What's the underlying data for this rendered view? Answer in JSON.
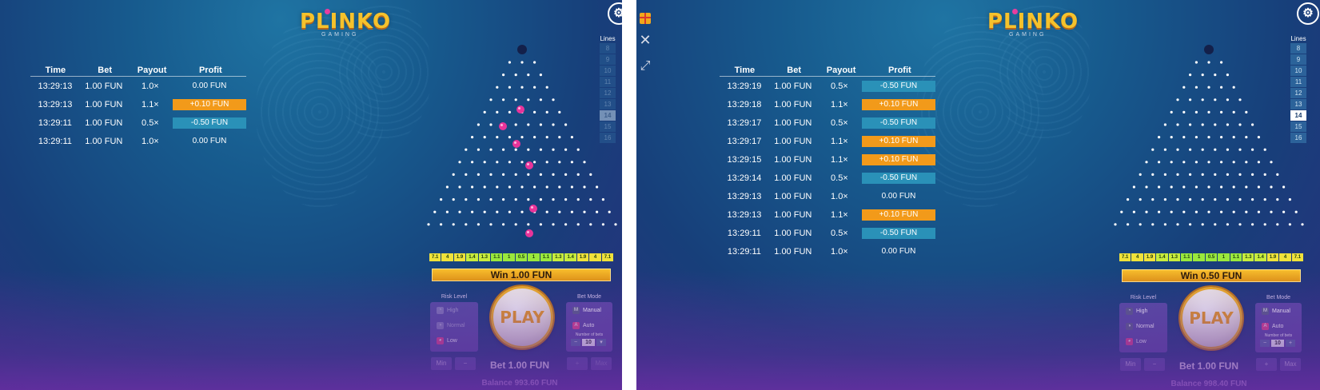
{
  "panel1": {
    "logo": {
      "title": "PLINKO",
      "subtitle": "GAMING"
    },
    "settings_icon": "settings-icon",
    "history": {
      "headers": [
        "Time",
        "Bet",
        "Payout",
        "Profit"
      ],
      "rows": [
        {
          "time": "13:29:13",
          "bet": "1.00 FUN",
          "payout": "1.0×",
          "profit": "0.00 FUN",
          "kind": "none"
        },
        {
          "time": "13:29:13",
          "bet": "1.00 FUN",
          "payout": "1.1×",
          "profit": "+0.10 FUN",
          "kind": "win"
        },
        {
          "time": "13:29:11",
          "bet": "1.00 FUN",
          "payout": "0.5×",
          "profit": "-0.50 FUN",
          "kind": "loss"
        },
        {
          "time": "13:29:11",
          "bet": "1.00 FUN",
          "payout": "1.0×",
          "profit": "0.00 FUN",
          "kind": "none"
        }
      ]
    },
    "lines": {
      "label": "Lines",
      "options": [
        "8",
        "9",
        "10",
        "11",
        "12",
        "13",
        "14",
        "15",
        "16"
      ],
      "selected": "14"
    },
    "multipliers": [
      "7.1",
      "4",
      "1.9",
      "1.4",
      "1.3",
      "1.1",
      "1",
      "0.5",
      "1",
      "1.1",
      "1.3",
      "1.4",
      "1.9",
      "4",
      "7.1"
    ],
    "win_text": "Win 1.00 FUN",
    "risk": {
      "title": "Risk Level",
      "options": [
        "High",
        "Normal",
        "Low"
      ],
      "selected": "Low"
    },
    "play_label": "PLAY",
    "bet_mode": {
      "title": "Bet Mode",
      "manual": "Manual",
      "auto": "Auto",
      "number_label": "Number of bets",
      "number": "10"
    },
    "bet_text": "Bet 1.00 FUN",
    "min_label": "Min",
    "max_label": "Max",
    "minus_label": "−",
    "plus_label": "+",
    "balance_text": "Balance 993.60 FUN"
  },
  "panel2": {
    "logo": {
      "title": "PLINKO",
      "subtitle": "GAMING"
    },
    "settings_icon": "settings-icon",
    "side_icons": [
      "gift-icon",
      "close-icon",
      "expand-icon"
    ],
    "history": {
      "headers": [
        "Time",
        "Bet",
        "Payout",
        "Profit"
      ],
      "rows": [
        {
          "time": "13:29:19",
          "bet": "1.00 FUN",
          "payout": "0.5×",
          "profit": "-0.50 FUN",
          "kind": "loss"
        },
        {
          "time": "13:29:18",
          "bet": "1.00 FUN",
          "payout": "1.1×",
          "profit": "+0.10 FUN",
          "kind": "win"
        },
        {
          "time": "13:29:17",
          "bet": "1.00 FUN",
          "payout": "0.5×",
          "profit": "-0.50 FUN",
          "kind": "loss"
        },
        {
          "time": "13:29:17",
          "bet": "1.00 FUN",
          "payout": "1.1×",
          "profit": "+0.10 FUN",
          "kind": "win"
        },
        {
          "time": "13:29:15",
          "bet": "1.00 FUN",
          "payout": "1.1×",
          "profit": "+0.10 FUN",
          "kind": "win"
        },
        {
          "time": "13:29:14",
          "bet": "1.00 FUN",
          "payout": "0.5×",
          "profit": "-0.50 FUN",
          "kind": "loss"
        },
        {
          "time": "13:29:13",
          "bet": "1.00 FUN",
          "payout": "1.0×",
          "profit": "0.00 FUN",
          "kind": "none"
        },
        {
          "time": "13:29:13",
          "bet": "1.00 FUN",
          "payout": "1.1×",
          "profit": "+0.10 FUN",
          "kind": "win"
        },
        {
          "time": "13:29:11",
          "bet": "1.00 FUN",
          "payout": "0.5×",
          "profit": "-0.50 FUN",
          "kind": "loss"
        },
        {
          "time": "13:29:11",
          "bet": "1.00 FUN",
          "payout": "1.0×",
          "profit": "0.00 FUN",
          "kind": "none"
        }
      ]
    },
    "lines": {
      "label": "Lines",
      "options": [
        "8",
        "9",
        "10",
        "11",
        "12",
        "13",
        "14",
        "15",
        "16"
      ],
      "selected": "14"
    },
    "multipliers": [
      "7.1",
      "4",
      "1.9",
      "1.4",
      "1.3",
      "1.1",
      "1",
      "0.5",
      "1",
      "1.1",
      "1.3",
      "1.4",
      "1.9",
      "4",
      "7.1"
    ],
    "win_text": "Win 0.50 FUN",
    "risk": {
      "title": "Risk Level",
      "options": [
        "High",
        "Normal",
        "Low"
      ],
      "selected": "Low"
    },
    "play_label": "PLAY",
    "bet_mode": {
      "title": "Bet Mode",
      "manual": "Manual",
      "auto": "Auto",
      "number_label": "Number of bets",
      "number": "10"
    },
    "bet_text": "Bet 1.00 FUN",
    "min_label": "Min",
    "max_label": "Max",
    "minus_label": "−",
    "plus_label": "+",
    "balance_text": "Balance 998.40 FUN"
  },
  "colors": {
    "win": "#f29a1a",
    "loss": "#2a91b8",
    "accent": "#f5c22c",
    "ball": "#e8349a"
  }
}
